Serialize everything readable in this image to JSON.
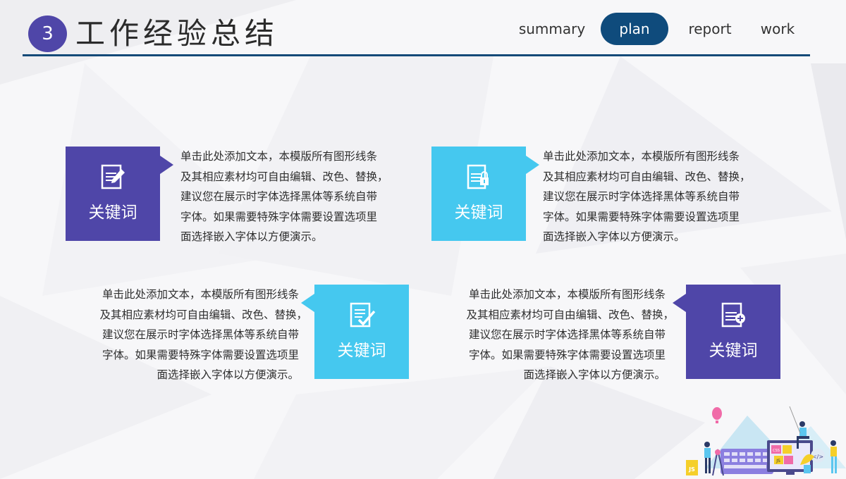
{
  "header": {
    "section_number": "3",
    "title": "工作经验总结"
  },
  "nav": {
    "items": [
      {
        "label": "summary",
        "active": false
      },
      {
        "label": "plan",
        "active": true
      },
      {
        "label": "report",
        "active": false
      },
      {
        "label": "work",
        "active": false
      }
    ]
  },
  "colors": {
    "purple": "#4f46a8",
    "cyan": "#45c8ef",
    "navy": "#0f4b7c"
  },
  "cards": [
    {
      "keyword": "关键词",
      "icon": "document-edit-icon",
      "color": "purple",
      "text_lines": [
        "单击此处添加文本，本模版所有图形线条",
        "及其相应素材均可自由编辑、改色、替换，",
        "建议您在展示时字体选择黑体等系统自带",
        "字体。如果需要特殊字体需要设置选项里",
        "面选择嵌入字体以方便演示。"
      ]
    },
    {
      "keyword": "关键词",
      "icon": "document-lock-icon",
      "color": "cyan",
      "text_lines": [
        "单击此处添加文本，本模版所有图形线条",
        "及其相应素材均可自由编辑、改色、替换，",
        "建议您在展示时字体选择黑体等系统自带",
        "字体。如果需要特殊字体需要设置选项里",
        "面选择嵌入字体以方便演示。"
      ]
    },
    {
      "keyword": "关键词",
      "icon": "document-check-icon",
      "color": "cyan",
      "text_lines": [
        "单击此处添加文本，本模版所有图形线条",
        "及其相应素材均可自由编辑、改色、替换，",
        "建议您在展示时字体选择黑体等系统自带",
        "字体。如果需要特殊字体需要设置选项里",
        "面选择嵌入字体以方便演示。"
      ]
    },
    {
      "keyword": "关键词",
      "icon": "document-add-icon",
      "color": "purple",
      "text_lines": [
        "单击此处添加文本，本模版所有图形线条",
        "及其相应素材均可自由编辑、改色、替换，",
        "建议您在展示时字体选择黑体等系统自带",
        "字体。如果需要特殊字体需要设置选项里",
        "面选择嵌入字体以方便演示。"
      ]
    }
  ],
  "illustration": {
    "labels": [
      "JS",
      "CSS",
      "JS",
      "</>"
    ]
  }
}
